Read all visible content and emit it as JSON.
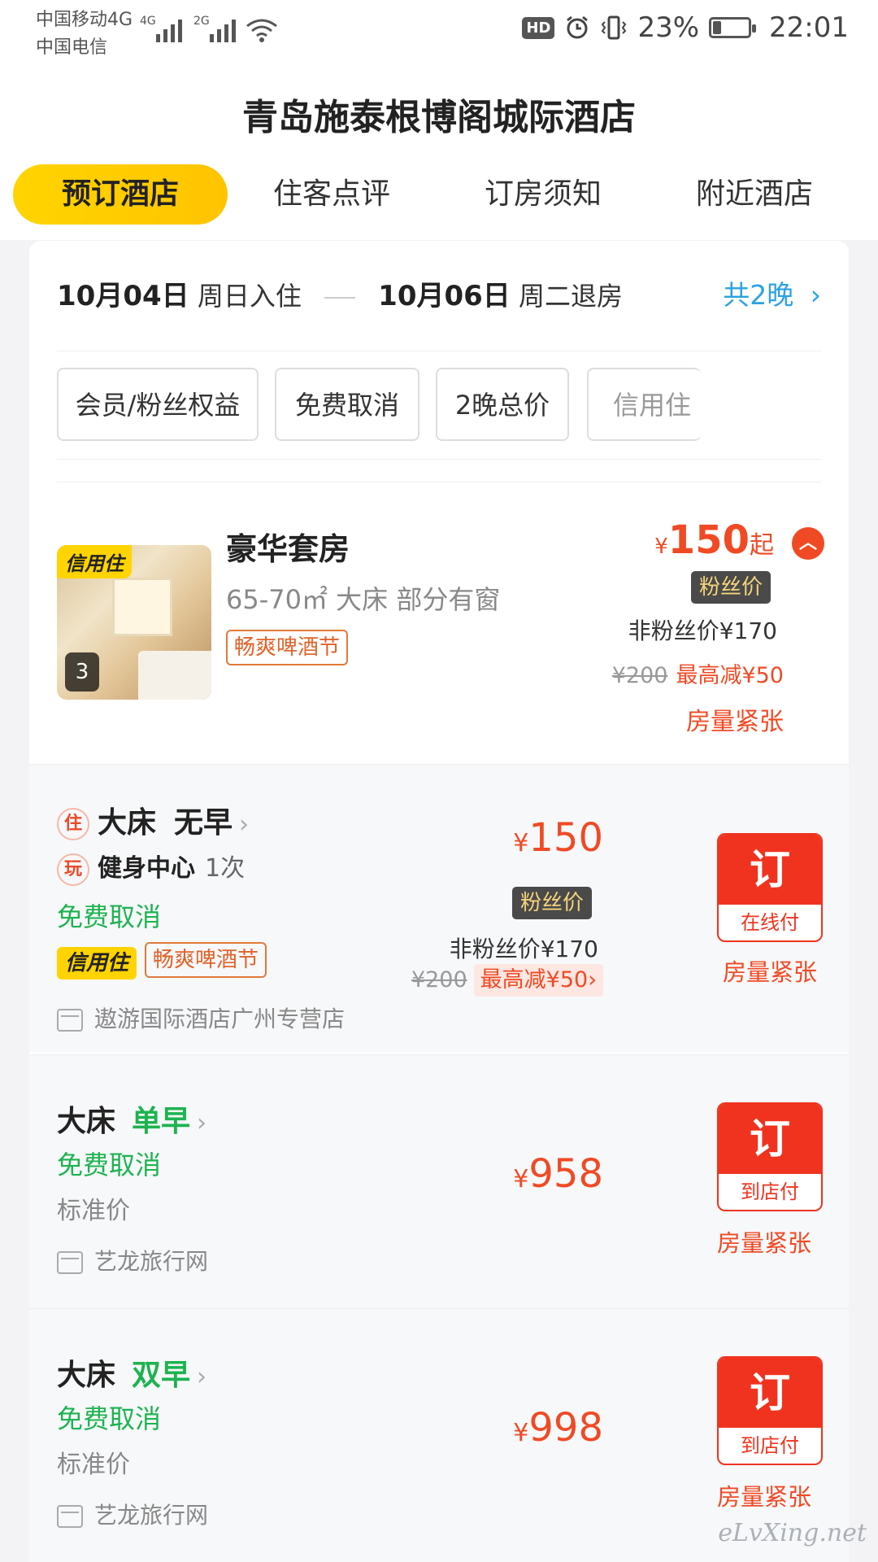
{
  "status_bar": {
    "carrier1": "中国移动4G",
    "carrier2": "中国电信",
    "sig1": "4G",
    "sig2": "2G",
    "hd": "HD",
    "battery": "23%",
    "battery_level": 0.23,
    "time": "22:01"
  },
  "header": {
    "title": "青岛施泰根博阁城际酒店",
    "tabs": [
      {
        "label": "预订酒店",
        "active": true
      },
      {
        "label": "住客点评",
        "active": false
      },
      {
        "label": "订房须知",
        "active": false
      },
      {
        "label": "附近酒店",
        "active": false
      }
    ]
  },
  "stay": {
    "checkin_date": "10月04日",
    "checkin_label": "周日入住",
    "checkout_date": "10月06日",
    "checkout_label": "周二退房",
    "nights": "共2晚"
  },
  "filters": [
    "会员/粉丝权益",
    "免费取消",
    "2晚总价",
    "信用住"
  ],
  "room": {
    "image_tag": "信用住",
    "photo_count": "3",
    "name": "豪华套房",
    "spec": "65-70㎡ 大床 部分有窗",
    "promo": "畅爽啤酒节",
    "price_symbol": "¥",
    "price": "150",
    "price_suffix": "起",
    "fan_badge": "粉丝价",
    "non_fan_price": "非粉丝价¥170",
    "orig_price": "¥200",
    "max_save": "最高减¥50",
    "availability": "房量紧张"
  },
  "rates": [
    {
      "icon_stay": "住",
      "bed": "大床",
      "breakfast": "无早",
      "icon_play": "玩",
      "extra": "健身中心",
      "extra_count": "1次",
      "cancel": "免费取消",
      "tag_credit": "信用住",
      "tag_promo": "畅爽啤酒节",
      "vendor": "遨游国际酒店广州专营店",
      "price_symbol": "¥",
      "price": "150",
      "fan_badge": "粉丝价",
      "non_fan_price": "非粉丝价¥170",
      "orig_price": "¥200",
      "max_save": "最高减¥50›",
      "book_label": "订",
      "pay_type": "在线付",
      "availability": "房量紧张"
    },
    {
      "bed": "大床",
      "breakfast": "单早",
      "cancel": "免费取消",
      "price_type": "标准价",
      "vendor": "艺龙旅行网",
      "price_symbol": "¥",
      "price": "958",
      "book_label": "订",
      "pay_type": "到店付",
      "availability": "房量紧张"
    },
    {
      "bed": "大床",
      "breakfast": "双早",
      "cancel": "免费取消",
      "price_type": "标准价",
      "vendor": "艺龙旅行网",
      "price_symbol": "¥",
      "price": "998",
      "book_label": "订",
      "pay_type": "到店付",
      "availability": "房量紧张"
    }
  ],
  "watermark": "eLvXing.net",
  "colors": {
    "accent_yellow": "#ffd400",
    "price_red": "#f04a24",
    "book_red": "#f0331f",
    "green": "#1db34f",
    "link_blue": "#2ba3e3"
  }
}
